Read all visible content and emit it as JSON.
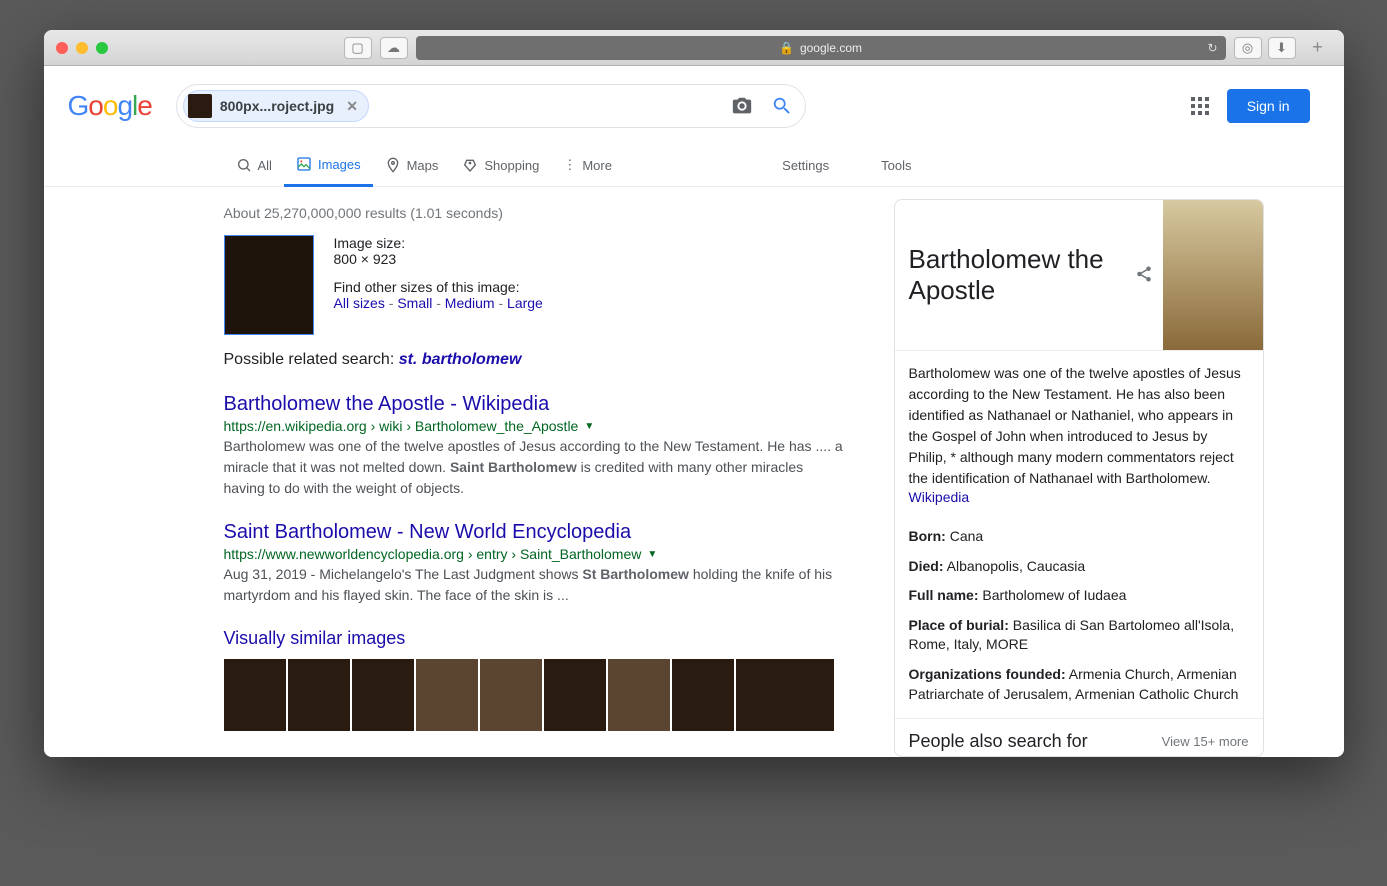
{
  "browser": {
    "domain": "google.com"
  },
  "header": {
    "signin": "Sign in"
  },
  "search": {
    "chip_filename": "800px...roject.jpg"
  },
  "tabs": {
    "all": "All",
    "images": "Images",
    "maps": "Maps",
    "shopping": "Shopping",
    "more": "More",
    "settings": "Settings",
    "tools": "Tools"
  },
  "stats": "About 25,270,000,000 results (1.01 seconds)",
  "imageInfo": {
    "sizeLabel": "Image size:",
    "sizeValue": "800 × 923",
    "findOther": "Find other sizes of this image:",
    "allSizes": "All sizes",
    "small": "Small",
    "medium": "Medium",
    "large": "Large"
  },
  "related": {
    "label": "Possible related search: ",
    "term": "st. bartholomew"
  },
  "results": [
    {
      "title": "Bartholomew the Apostle - Wikipedia",
      "url": "https://en.wikipedia.org › wiki › Bartholomew_the_Apostle",
      "snippet_pre": "Bartholomew was one of the twelve apostles of Jesus according to the New Testament. He has .... a miracle that it was not melted down. ",
      "snippet_bold": "Saint Bartholomew",
      "snippet_post": " is credited with many other miracles having to do with the weight of objects."
    },
    {
      "title": "Saint Bartholomew - New World Encyclopedia",
      "url": "https://www.newworldencyclopedia.org › entry › Saint_Bartholomew",
      "snippet_pre": "Aug 31, 2019 - Michelangelo's The Last Judgment shows ",
      "snippet_bold": "St Bartholomew",
      "snippet_post": " holding the knife of his martyrdom and his flayed skin. The face of the skin is ..."
    }
  ],
  "vsi": {
    "title": "Visually similar images"
  },
  "kp": {
    "title": "Bartholomew the Apostle",
    "desc": "Bartholomew was one of the twelve apostles of Jesus according to the New Testament. He has also been identified as Nathanael or Nathaniel, who appears in the Gospel of John when introduced to Jesus by Philip, * although many modern commentators reject the identification of Nathanael with Bartholomew.",
    "source": "Wikipedia",
    "facts": {
      "bornLabel": "Born:",
      "bornValue": "Cana",
      "diedLabel": "Died:",
      "diedValue1": "Albanopolis",
      "diedValue2": "Caucasia",
      "fullLabel": "Full name:",
      "fullValue": "Bartholomew of Iudaea",
      "burialLabel": "Place of burial:",
      "burialValue1": "Basilica di San Bartolomeo all'Isola, Rome, Italy",
      "burialMore": "MORE",
      "orgLabel": "Organizations founded:",
      "org1": "Armenia Church",
      "org2": "Armenian Patriarchate of Jerusalem",
      "org3": "Armenian Catholic Church"
    },
    "pasf": "People also search for",
    "pasfMore": "View 15+ more"
  }
}
